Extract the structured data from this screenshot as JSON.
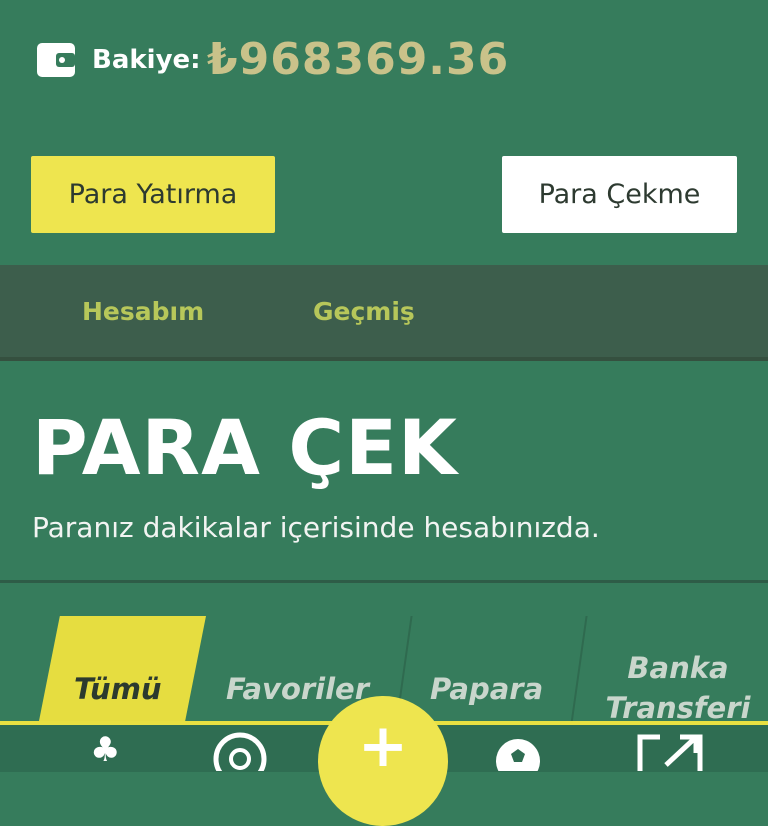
{
  "balance": {
    "label": "Bakiye:",
    "value": "₺968369.36"
  },
  "actions": {
    "deposit_label": "Para Yatırma",
    "withdraw_label": "Para Çekme"
  },
  "subnav": {
    "items": [
      "Hesabım",
      "Geçmiş"
    ]
  },
  "page": {
    "title": "PARA ÇEK",
    "subtitle": "Paranız dakikalar içerisinde hesabınızda."
  },
  "tabs": {
    "items": [
      "Tümü",
      "Favoriler",
      "Papara",
      "Banka Transferi"
    ],
    "active": "Tümü"
  },
  "bottom_nav": {
    "icons": [
      "clover-icon",
      "roulette-icon",
      "plus-icon",
      "soccer-ball-icon",
      "external-link-icon"
    ]
  },
  "colors": {
    "background": "#367c5c",
    "accent": "#eee54f",
    "subnav_bg": "#3d5e4c",
    "balance_value": "#c9c28a",
    "subnav_text": "#b7c75a"
  }
}
